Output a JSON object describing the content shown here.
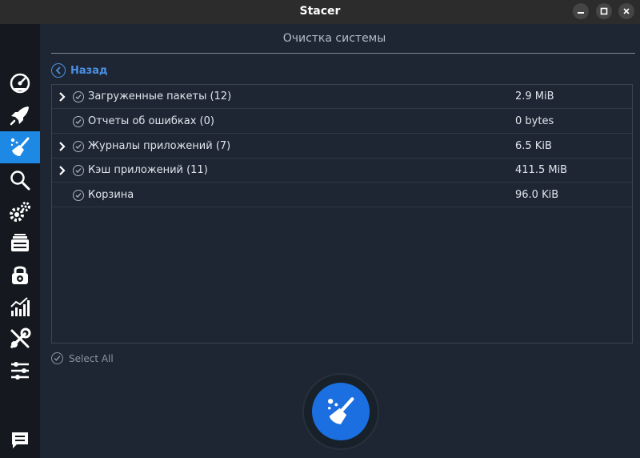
{
  "window": {
    "title": "Stacer"
  },
  "colors": {
    "accent": "#1e88e5",
    "background": "#1f2633",
    "sidebar": "#15191f",
    "link": "#4a90e2"
  },
  "sidebar": {
    "items": [
      {
        "icon": "dashboard-speedometer-icon",
        "active": false
      },
      {
        "icon": "rocket-icon",
        "active": false
      },
      {
        "icon": "broom-cleaner-icon",
        "active": true
      },
      {
        "icon": "search-icon",
        "active": false
      },
      {
        "icon": "gears-icon",
        "active": false
      },
      {
        "icon": "uninstaller-icon",
        "active": false
      },
      {
        "icon": "lock-icon",
        "active": false
      },
      {
        "icon": "resources-chart-icon",
        "active": false
      },
      {
        "icon": "tools-icon",
        "active": false
      },
      {
        "icon": "settings-sliders-icon",
        "active": false
      },
      {
        "icon": "feedback-message-icon",
        "active": false
      }
    ]
  },
  "main": {
    "title": "Очистка системы",
    "back_label": "Назад",
    "rows": [
      {
        "name": "Загруженные пакеты (12)",
        "size": "2.9 MiB",
        "expandable": true
      },
      {
        "name": "Отчеты об ошибках (0)",
        "size": "0 bytes",
        "expandable": false
      },
      {
        "name": "Журналы приложений (7)",
        "size": "6.5 KiB",
        "expandable": true
      },
      {
        "name": "Кэш приложений (11)",
        "size": "411.5 MiB",
        "expandable": true
      },
      {
        "name": "Корзина",
        "size": "96.0 KiB",
        "expandable": false
      }
    ],
    "select_all_label": "Select All",
    "clean_button_icon": "broom-icon"
  }
}
